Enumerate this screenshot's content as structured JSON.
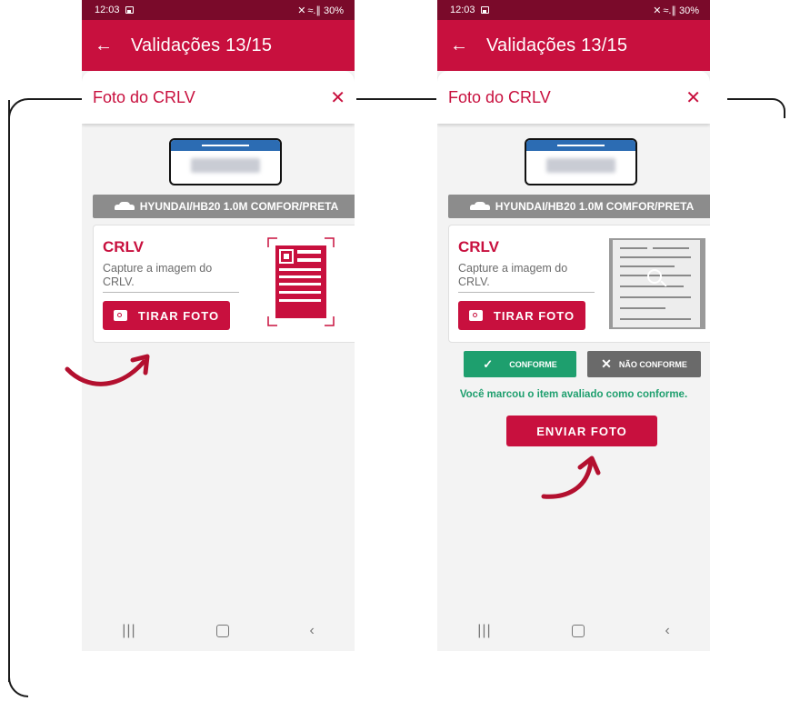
{
  "status": {
    "time": "12:03",
    "right": "✕ ≈.∥ 30%"
  },
  "appbar": {
    "title": "Validações 13/15"
  },
  "sheet": {
    "title": "Foto do CRLV",
    "close": "✕"
  },
  "vehicle": {
    "label": "HYUNDAI/HB20 1.0M COMFOR/PRETA"
  },
  "card": {
    "title": "CRLV",
    "description": "Capture a imagem do CRLV.",
    "photo_button": "TIRAR FOTO"
  },
  "actions": {
    "conforme": "CONFORME",
    "nao_conforme": "NÃO CONFORME",
    "message": "Você marcou o item avaliado como conforme.",
    "send": "ENVIAR FOTO"
  },
  "colors": {
    "primary": "#c8103e",
    "status_bar": "#7a0a2a",
    "success": "#1e9f6e",
    "neutral": "#6a6a6a"
  },
  "icons": [
    "back-arrow-icon",
    "close-icon",
    "car-icon",
    "camera-icon",
    "document-qr-icon",
    "zoom-icon",
    "check-icon",
    "x-icon"
  ]
}
